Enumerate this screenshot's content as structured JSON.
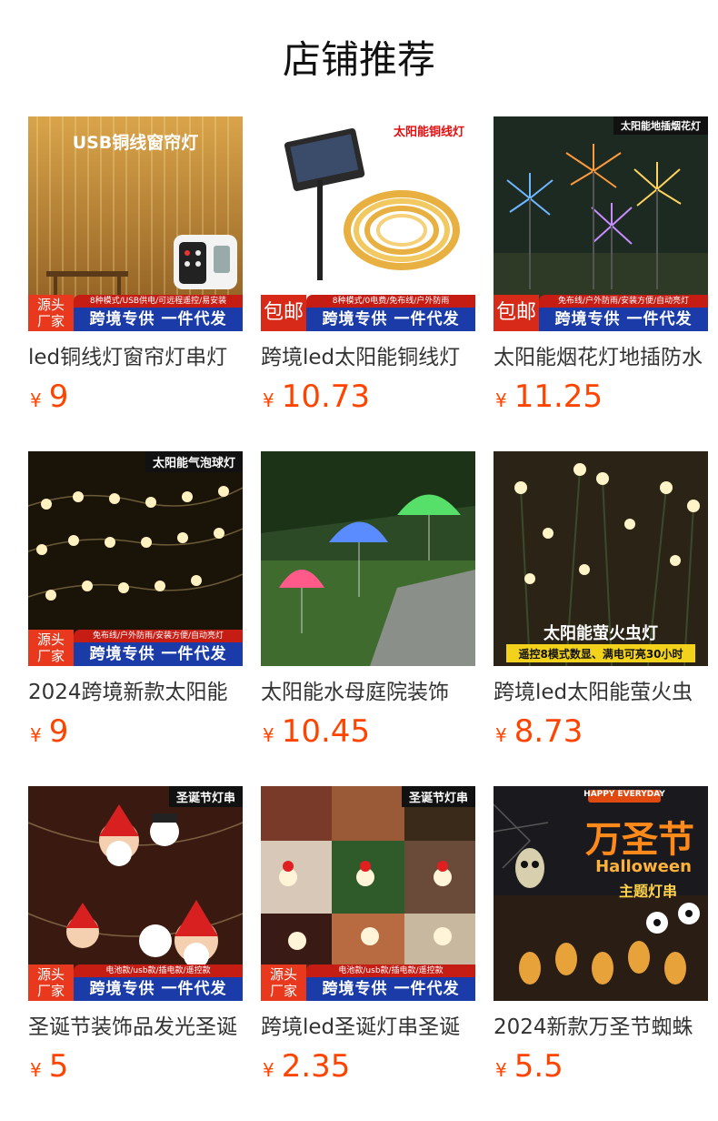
{
  "page": {
    "title": "店铺推荐"
  },
  "currency": "¥",
  "products": [
    {
      "title": "led铜线灯窗帘灯串灯",
      "price": "9",
      "image": {
        "overlay_text": "USB铜线窗帘灯",
        "left_tag": [
          "源头",
          "厂家"
        ],
        "strip_text": "8种模式/USB供电/可远程遥控/易安装",
        "bar_text": "跨境专供  一件代发"
      }
    },
    {
      "title": "跨境led太阳能铜线灯",
      "price": "10.73",
      "image": {
        "corner_label": "太阳能铜线灯",
        "left_tag": [
          "包邮"
        ],
        "strip_text": "8种模式/0电费/免布线/户外防雨",
        "bar_text": "跨境专供  一件代发"
      }
    },
    {
      "title": "太阳能烟花灯地插防水",
      "price": "11.25",
      "image": {
        "corner_label": "太阳能地插烟花灯",
        "left_tag": [
          "包邮"
        ],
        "strip_text": "免布线/户外防雨/安装方便/自动亮灯",
        "bar_text": "跨境专供  一件代发"
      }
    },
    {
      "title": "2024跨境新款太阳能",
      "price": "9",
      "image": {
        "corner_label": "太阳能气泡球灯",
        "left_tag": [
          "源头",
          "厂家"
        ],
        "strip_text": "免布线/户外防雨/安装方便/自动亮灯",
        "bar_text": "跨境专供  一件代发"
      }
    },
    {
      "title": "太阳能水母庭院装饰",
      "price": "10.45",
      "image": {}
    },
    {
      "title": "跨境led太阳能萤火虫",
      "price": "8.73",
      "image": {
        "overlay_text": "太阳能萤火虫灯",
        "sub_text": "遥控8模式数显、满电可亮30小时"
      }
    },
    {
      "title": "圣诞节装饰品发光圣诞",
      "price": "5",
      "image": {
        "corner_label": "圣诞节灯串",
        "left_tag": [
          "源头",
          "厂家"
        ],
        "strip_text": "电池款/usb款/插电款/遥控款",
        "bar_text": "跨境专供  一件代发"
      }
    },
    {
      "title": "跨境led圣诞灯串圣诞",
      "price": "2.35",
      "image": {
        "corner_label": "圣诞节灯串",
        "left_tag": [
          "源头",
          "厂家"
        ],
        "strip_text": "电池款/usb款/插电款/遥控款",
        "bar_text": "跨境专供  一件代发"
      }
    },
    {
      "title": "2024新款万圣节蜘蛛",
      "price": "5.5",
      "image": {
        "overlay_text": "万圣节",
        "sub_text": "Halloween",
        "sub_text_2": "主题灯串",
        "badge": "HAPPY EVERYDAY"
      }
    }
  ]
}
